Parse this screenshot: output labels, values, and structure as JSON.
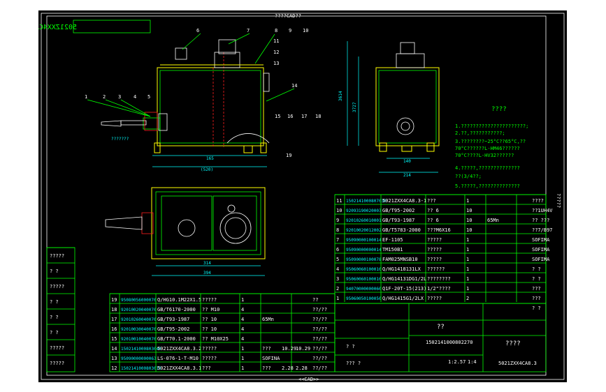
{
  "header": {
    "top_label": "????CAD??",
    "bottom_label": "<<CAD>>",
    "part_code_box": "5021ZXX4CA8.3"
  },
  "callouts_top": [
    "6",
    "7",
    "8",
    "9",
    "10",
    "11",
    "12",
    "13",
    "14",
    "1",
    "2",
    "3",
    "4",
    "5",
    "15",
    "16",
    "17",
    "18",
    "19"
  ],
  "dims": {
    "front_width": "165",
    "front_total": "(520)",
    "side_height": "3614",
    "side_height2": "3727",
    "side_base": "140",
    "side_total": "214",
    "plan_width": "314",
    "plan_total": "394",
    "left_note": "???????"
  },
  "notes": {
    "title": "????",
    "lines": [
      "1.??????????????????????;",
      "2.??,???????????;",
      "3.????????~25°C??65°C,??",
      "  70°C??????L-HM46??????",
      "  70°C????L-HV32??????",
      "4.?????,??????????????",
      "  ??(3/4??;",
      "5.?????,??????????????"
    ]
  },
  "vertical_label": "?????",
  "left_panel": [
    "?????",
    "? ?",
    "?????",
    "? ?",
    "? ?",
    "? ?",
    "?????",
    "?????"
  ],
  "bom_upper": [
    {
      "no": "11",
      "code": "1502141000807030",
      "name": "5021ZXX4CA8.3-1",
      "spec": "???",
      "qty": "1"
    },
    {
      "no": "10",
      "code": "92093190020003",
      "name": "GB/T95-2002",
      "spec": "?? 6",
      "qty": "10"
    },
    {
      "no": "9",
      "code": "92010260010001",
      "name": "GB/T93-1987",
      "spec": "?? 6",
      "qty": "10",
      "mat": "65Mn"
    },
    {
      "no": "8",
      "code": "92010020012002",
      "name": "GB/T5783-2000",
      "spec": "???M6X16",
      "qty": "10"
    },
    {
      "no": "7",
      "code": "95090000100014",
      "name": "EF-1105",
      "spec": "?????",
      "qty": "1"
    },
    {
      "no": "6",
      "code": "95090000000014",
      "name": "TM150B1",
      "spec": "?????",
      "qty": "1"
    },
    {
      "no": "5",
      "code": "95090000100078",
      "name": "FAM025MNSB10",
      "spec": "?????",
      "qty": "1"
    },
    {
      "no": "4",
      "code": "95060060100010",
      "name": "Q/HG1418131LX",
      "spec": "??????",
      "qty": "1"
    },
    {
      "no": "3",
      "code": "95060060100010",
      "name": "Q/HG14131DG1/2L",
      "spec": "????????",
      "qty": "1"
    },
    {
      "no": "2",
      "code": "94070000000060",
      "name": "Q1F-20T-15(213)",
      "spec": "1/2\"????",
      "qty": "1"
    },
    {
      "no": "1",
      "code": "95060050100050",
      "name": "Q/HG1415G1/2LX",
      "spec": "?????",
      "qty": "2"
    }
  ],
  "bom_upper_right": [
    "????",
    "??1UH4V",
    "?? ???",
    "??7/B97",
    "SOFIMA",
    "SOFIMA",
    "SOFIMA",
    "? ?",
    "? ?",
    "???",
    "???",
    "? ?"
  ],
  "bom_lower": [
    {
      "no": "19",
      "code": "95080056000070",
      "name": "Q/HG10.1M22X1.5",
      "spec": "?????",
      "qty": "1"
    },
    {
      "no": "18",
      "code": "92010020040070",
      "name": "GB/T6170-2000",
      "spec": "?? M10",
      "qty": "4"
    },
    {
      "no": "17",
      "code": "92010260040070",
      "name": "GB/T93-1987",
      "spec": "?? 10",
      "qty": "4",
      "mat": "65Mn"
    },
    {
      "no": "16",
      "code": "92010030040070",
      "name": "GB/T95-2002",
      "spec": "?? 10",
      "qty": "4"
    },
    {
      "no": "15",
      "code": "92010010040070",
      "name": "GB/T70.1-2000",
      "spec": "?? M10X25",
      "qty": "4"
    },
    {
      "no": "14",
      "code": "1502141000803040",
      "name": "5021ZXX4CA8.3.2",
      "spec": "?????",
      "qty": "1",
      "mat": "???",
      "w1": "10.29",
      "w2": "10.29"
    },
    {
      "no": "13",
      "code": "95090000000063",
      "name": "LS-076-1-T-M10",
      "spec": "?????",
      "qty": "1",
      "mat": "SOFINA"
    },
    {
      "no": "12",
      "code": "1502141000803010",
      "name": "5021ZXX4CA8.3.1",
      "spec": "???",
      "qty": "1",
      "mat": "???",
      "w1": "2.28",
      "w2": "2.28"
    }
  ],
  "bom_lower_right": [
    "??",
    "??/??",
    "??/??",
    "??/??",
    "??/??",
    "??/??",
    "??/??",
    "??/??"
  ],
  "title_block": {
    "company": "??",
    "drawing_no": "1502141000802270",
    "name": "????",
    "part_code": "5021ZXX4CA8.3",
    "scale": "1:2.57",
    "sheet": "1:4",
    "h1": "? ?",
    "h2": "??? ?"
  }
}
